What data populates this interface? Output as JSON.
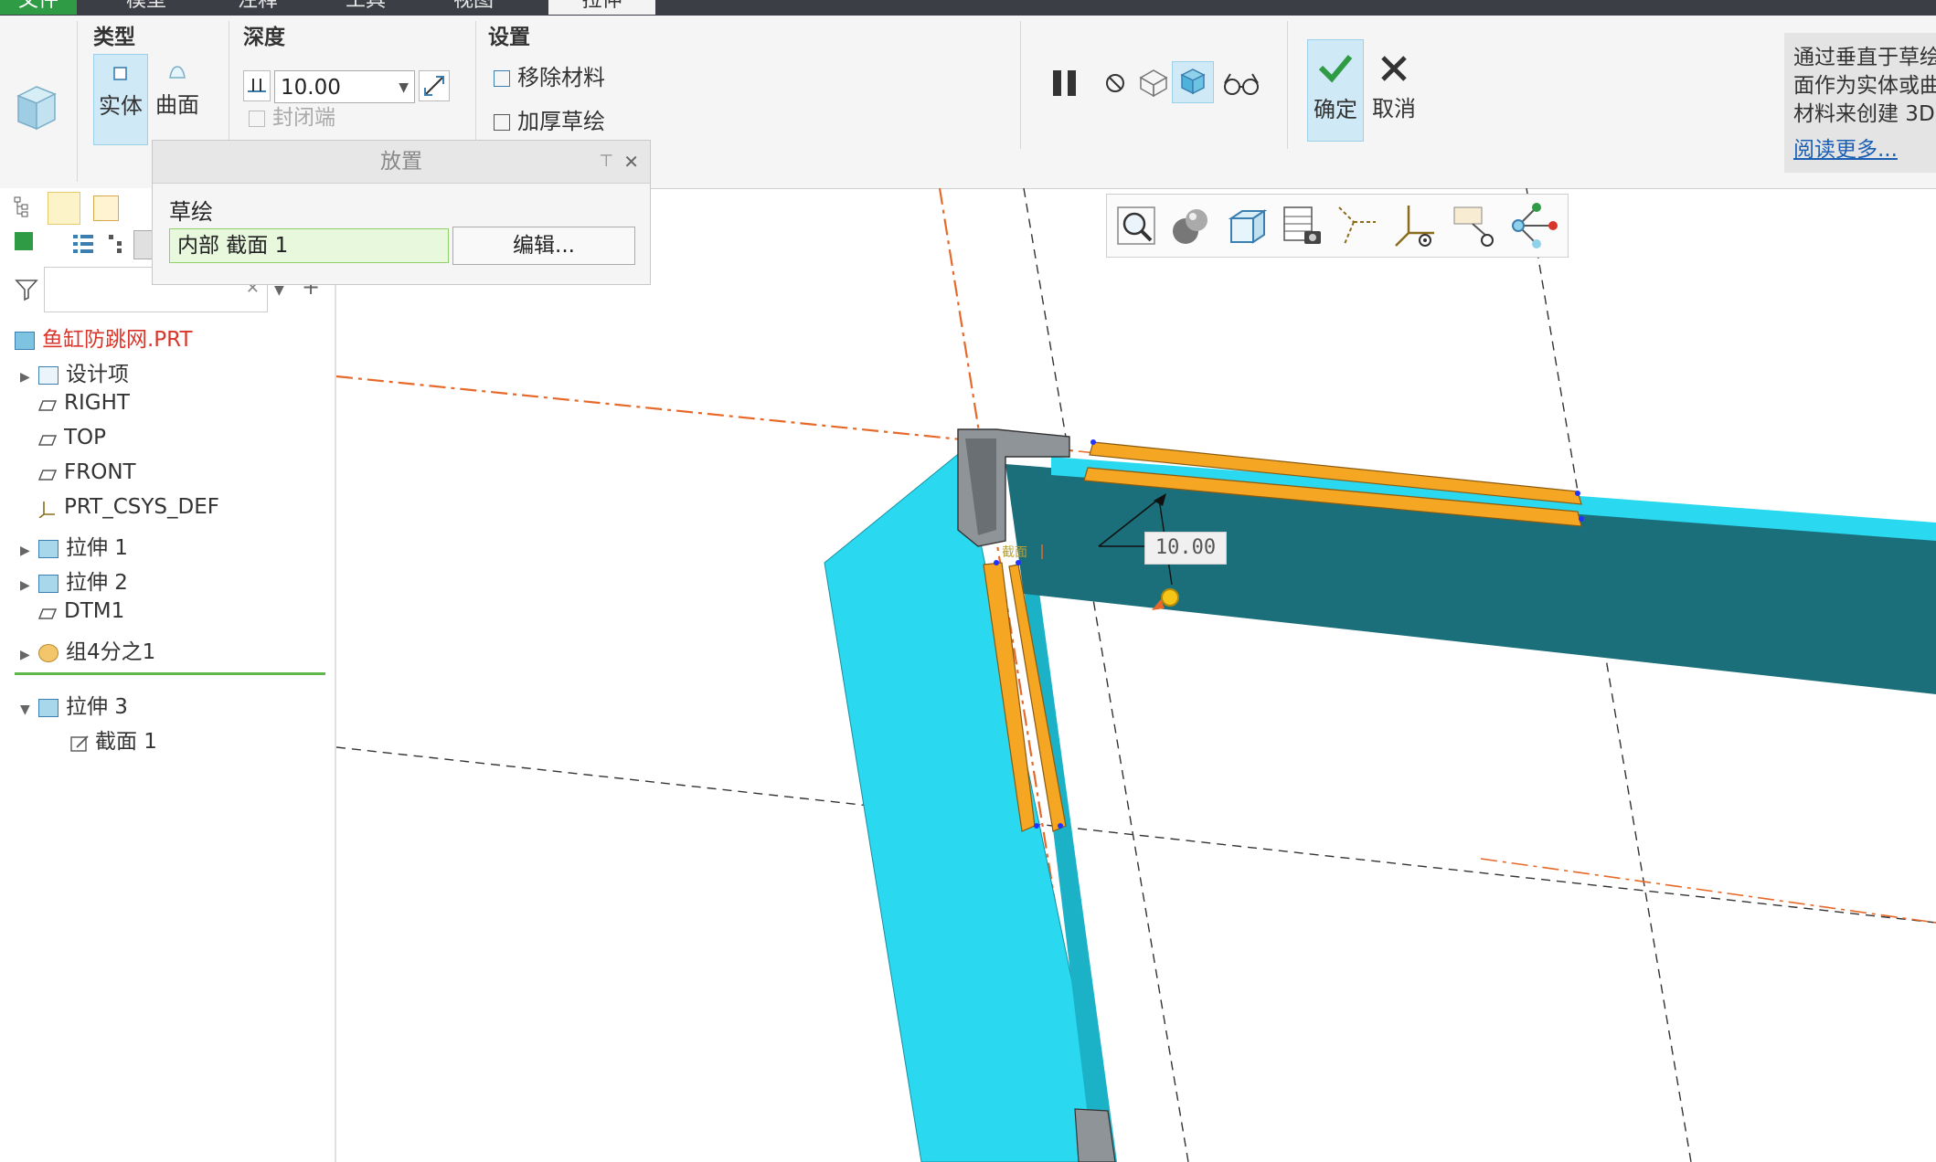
{
  "window": {
    "tabs": [
      {
        "label": "文件"
      },
      {
        "label": "模型"
      },
      {
        "label": "注释"
      },
      {
        "label": "工具"
      },
      {
        "label": "视图"
      },
      {
        "label": "拉伸"
      }
    ]
  },
  "ribbon": {
    "type_group": {
      "label": "类型",
      "solid": "实体",
      "surface": "曲面"
    },
    "depth_group": {
      "label": "深度",
      "value": "10.00",
      "cap_ends": "封闭端"
    },
    "settings_group": {
      "label": "设置",
      "remove_material": "移除材料",
      "thicken_sketch": "加厚草绘"
    },
    "confirm": "确定",
    "cancel": "取消"
  },
  "help": {
    "lines": [
      "通过垂直于草绘",
      "面作为实体或曲",
      "材料来创建 3D"
    ],
    "more": "阅读更多..."
  },
  "placement_panel": {
    "title": "放置",
    "sketch_label": "草绘",
    "sketch_value": "内部 截面 1",
    "edit_button": "编辑..."
  },
  "model_tree": {
    "root": "鱼缸防跳网.PRT",
    "items": [
      {
        "label": "设计项"
      },
      {
        "label": "RIGHT"
      },
      {
        "label": "TOP"
      },
      {
        "label": "FRONT"
      },
      {
        "label": "PRT_CSYS_DEF"
      },
      {
        "label": "拉伸 1"
      },
      {
        "label": "拉伸 2"
      },
      {
        "label": "DTM1"
      },
      {
        "label": "组4分之1"
      }
    ],
    "active": {
      "label": "拉伸 3",
      "child": "截面 1"
    }
  },
  "viewport": {
    "dimension_value": "10.00",
    "sketch_tag": "截面"
  },
  "colors": {
    "accent_green": "#2f9b45",
    "part_cyan": "#2ad8ef",
    "part_teal": "#1a6f7a",
    "sketch_orange": "#f5a623",
    "datum_orange": "#e6692a"
  }
}
